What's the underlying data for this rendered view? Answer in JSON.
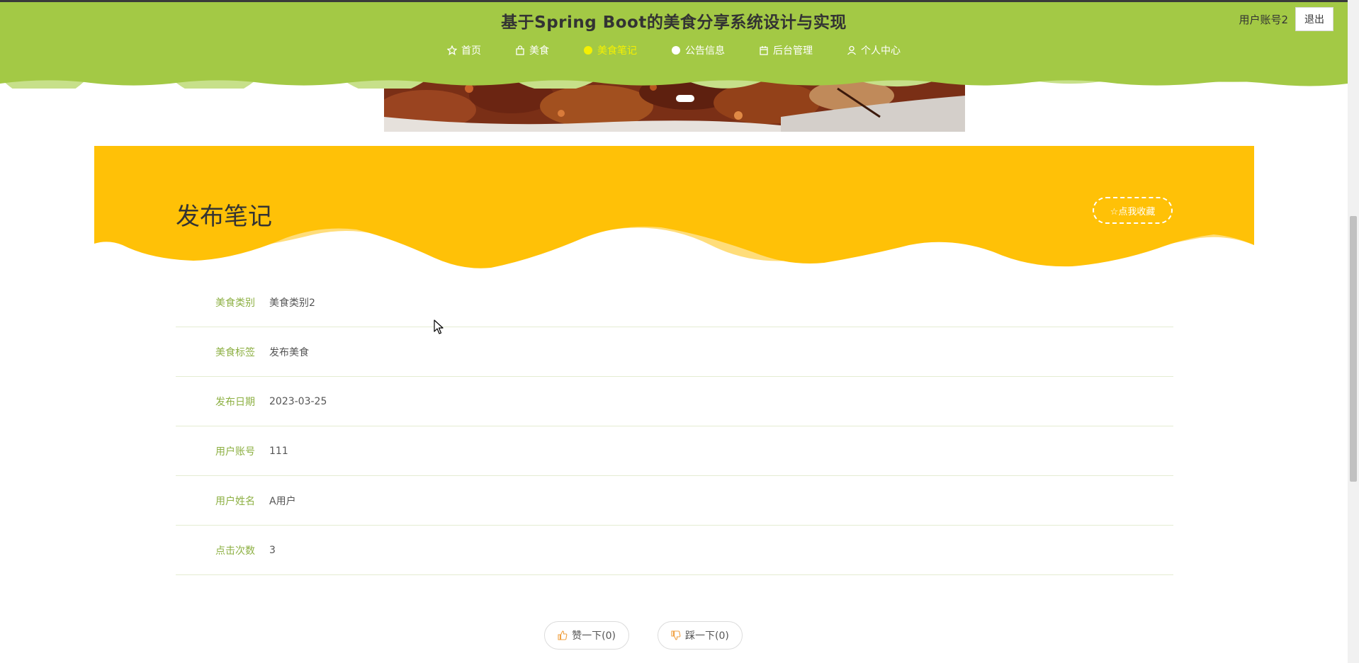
{
  "header": {
    "site_title": "基于Spring Boot的美食分享系统设计与实现",
    "user_name": "用户账号2",
    "logout_label": "退出",
    "bg_color": "#a3c945",
    "nav": [
      {
        "label": "首页",
        "icon": "star-icon",
        "active": false
      },
      {
        "label": "美食",
        "icon": "bag-icon",
        "active": false
      },
      {
        "label": "美食笔记",
        "icon": "circle-icon",
        "active": true
      },
      {
        "label": "公告信息",
        "icon": "circle-icon",
        "active": false
      },
      {
        "label": "后台管理",
        "icon": "box-icon",
        "active": false
      },
      {
        "label": "个人中心",
        "icon": "user-icon",
        "active": false
      }
    ]
  },
  "note": {
    "title": "发布笔记",
    "favorite_label": "☆点我收藏",
    "accent_color": "#ffc107",
    "label_color": "#8db043",
    "fields": [
      {
        "label": "美食类别",
        "value": "美食类别2"
      },
      {
        "label": "美食标签",
        "value": "发布美食"
      },
      {
        "label": "发布日期",
        "value": "2023-03-25"
      },
      {
        "label": "用户账号",
        "value": "111"
      },
      {
        "label": "用户姓名",
        "value": "A用户"
      },
      {
        "label": "点击次数",
        "value": "3"
      }
    ]
  },
  "actions": {
    "like_label": "赞一下(0)",
    "dislike_label": "踩一下(0)"
  }
}
